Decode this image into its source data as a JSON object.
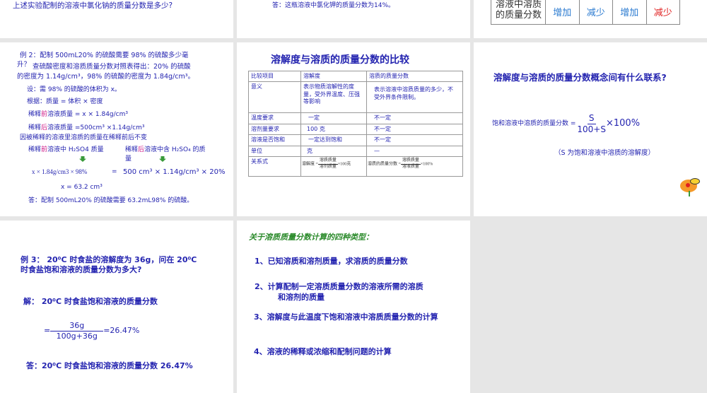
{
  "slides": [
    {
      "text": "上述实验配制的溶液中氯化钠的质量分数是多少?"
    },
    {
      "text": "答：这瓶溶液中氯化钾的质量分数为14%。"
    },
    {
      "table_row": {
        "label_line1": "溶液中溶质",
        "label_line2": "的质量分数",
        "cells": [
          "增加",
          "减少",
          "增加",
          "减少"
        ]
      }
    },
    {
      "lines": [
        "例 2：配制 500mL20% 的硫酸需要 98% 的硫酸多少毫",
        "升？",
        "查硫酸密度和溶质质量分数对照表得出：20% 的硫酸",
        "的密度为 1.14g/cm³，98% 的硫酸的密度为 1.84g/cm³。",
        "设：需 98% 的硫酸的体积为 x。",
        "根据：质量 = 体积 × 密度",
        "稀释",
        "前",
        "溶液质量 = x × 1.84g/cm³",
        "后",
        "溶液质量 =500cm³ ×1.14g/cm³",
        "因被稀释的溶液里溶质的质量在稀释前后不变",
        "溶液中 H₂SO4 质量",
        "溶液中含 H₂SO₄ 的质",
        "量",
        "x × 1.84g/cm3 × 98%",
        "=",
        "500 cm³ × 1.14g/cm³ × 20%",
        "x = 63.2 cm³",
        "答：配制 500mL20% 的硫酸需要 63.2mL98% 的硫酸。"
      ]
    },
    {
      "title": "溶解度与溶质的质量分数的比较",
      "headers": [
        "比较项目",
        "溶解度",
        "溶质的质量分数"
      ],
      "rows": [
        [
          "意义",
          "表示物质溶解性的度量，受外界温度、压强等影响",
          "表示溶液中溶质质量的多少，不受外界条件限制。"
        ],
        [
          "温度要求",
          "一定",
          "不一定"
        ],
        [
          "溶剂量要求",
          "100 克",
          "不一定"
        ],
        [
          "溶液是否饱和",
          "一定达到饱和",
          "不一定"
        ],
        [
          "单位",
          "克",
          "—"
        ]
      ],
      "formula_row": {
        "label": "关系式",
        "f1_left": "溶解度 =",
        "f1_num": "溶质质量",
        "f1_den": "溶剂质量",
        "f1_right": "×100克",
        "f2_left": "溶质的质量分数 =",
        "f2_num": "溶质质量",
        "f2_den": "溶液质量",
        "f2_right": "×100%"
      }
    },
    {
      "question": "溶解度与溶质的质量分数概念间有什么联系?",
      "formula_left": "饱和溶液中溶质的质量分数 =",
      "num": "S",
      "den": "100+S",
      "right": "×100%",
      "note": "（S 为饱和溶液中溶质的溶解度）"
    },
    {
      "line1": "例 3： 20⁰C 时食盐的溶解度为 36g，问在 20⁰C",
      "line2": "时食盐饱和溶液的质量分数为多大?",
      "sol": "解：   20⁰C 时食盐饱和溶液的质量分数",
      "num": "36g",
      "den": "100g+36g",
      "result": "=26.47%",
      "eq": "=",
      "answer": "答：20⁰C 时食盐饱和溶液的质量分数 26.47%"
    },
    {
      "title": "关于溶质质量分数计算的四种类型：",
      "items": [
        "1、已知溶质和溶剂质量，求溶质的质量分数",
        "2、计算配制一定溶质质量分数的溶液所需的溶质",
        "和溶剂的质量",
        "3、溶解度与此温度下饱和溶液中溶质质量分数的计算",
        "4、溶液的稀释或浓缩和配制问题的计算"
      ]
    }
  ],
  "colors": {
    "text": "#2424b0",
    "green": "#2a8a2a",
    "red": "#e02020",
    "pink": "#d0208a",
    "cell_blue": "#2a7ad0"
  }
}
